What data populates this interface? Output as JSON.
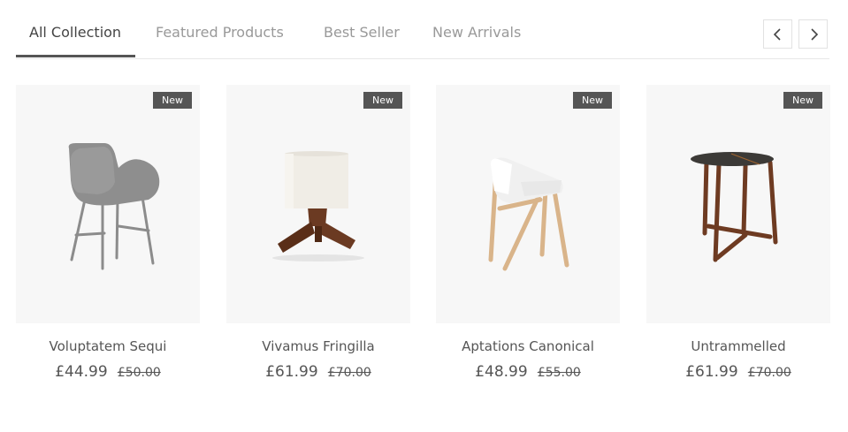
{
  "tabs": [
    {
      "label": "All Collection",
      "active": true
    },
    {
      "label": "Featured Products",
      "active": false
    },
    {
      "label": "Best Seller",
      "active": false
    },
    {
      "label": "New Arrivals",
      "active": false
    }
  ],
  "nav": {
    "prev_icon": "chevron-left-icon",
    "next_icon": "chevron-right-icon"
  },
  "products": [
    {
      "badge": "New",
      "name": "Voluptatem Sequi",
      "price": "£44.99",
      "old_price": "£50.00",
      "image": "grey-armchair"
    },
    {
      "badge": "New",
      "name": "Vivamus Fringilla",
      "price": "£61.99",
      "old_price": "£70.00",
      "image": "table-lamp"
    },
    {
      "badge": "New",
      "name": "Aptations Canonical",
      "price": "£48.99",
      "old_price": "£55.00",
      "image": "wooden-chair"
    },
    {
      "badge": "New",
      "name": "Untrammelled",
      "price": "£61.99",
      "old_price": "£70.00",
      "image": "side-table"
    }
  ],
  "colors": {
    "badge_bg": "#555555",
    "card_bg": "#f7f7f7",
    "active_tab": "#444444",
    "inactive_tab": "#999999"
  }
}
